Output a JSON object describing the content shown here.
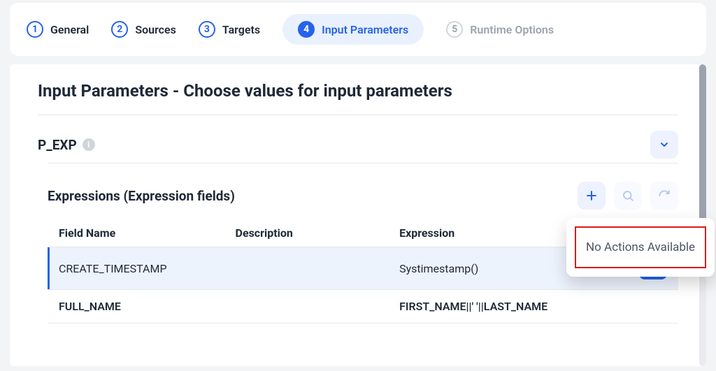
{
  "wizard": {
    "steps": [
      {
        "num": "1",
        "label": "General"
      },
      {
        "num": "2",
        "label": "Sources"
      },
      {
        "num": "3",
        "label": "Targets"
      },
      {
        "num": "4",
        "label": "Input Parameters"
      },
      {
        "num": "5",
        "label": "Runtime Options"
      }
    ]
  },
  "page_title": "Input Parameters - Choose values for input parameters",
  "param_name": "P_EXP",
  "section_title": "Expressions (Expression fields)",
  "table": {
    "headers": {
      "field": "Field Name",
      "desc": "Description",
      "expr": "Expression"
    },
    "rows": [
      {
        "field": "CREATE_TIMESTAMP",
        "desc": "",
        "expr": "Systimestamp()",
        "selected": true
      },
      {
        "field": "FULL_NAME",
        "desc": "",
        "expr": "FIRST_NAME||' '||LAST_NAME",
        "selected": false
      }
    ]
  },
  "popover_text": "No Actions Available",
  "icons": {
    "info": "i"
  }
}
